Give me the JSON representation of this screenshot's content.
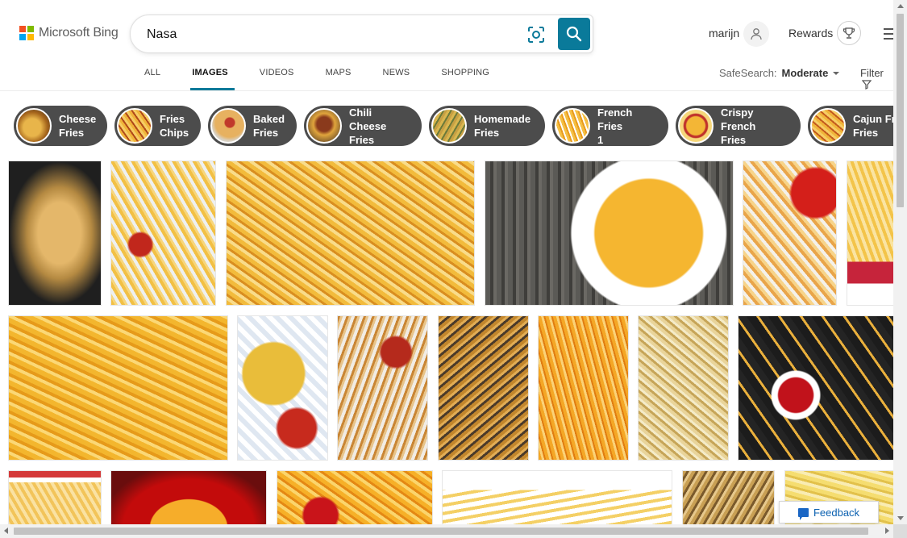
{
  "header": {
    "logo_text": "Microsoft Bing",
    "logo_colors": [
      "#f25022",
      "#7fba00",
      "#00a4ef",
      "#ffb900"
    ],
    "search_value": "Nasa",
    "accent_color": "#0a7a9a",
    "user_name": "marijn",
    "rewards_label": "Rewards"
  },
  "tabs": [
    {
      "label": "ALL",
      "active": false
    },
    {
      "label": "IMAGES",
      "active": true
    },
    {
      "label": "VIDEOS",
      "active": false
    },
    {
      "label": "MAPS",
      "active": false
    },
    {
      "label": "NEWS",
      "active": false
    },
    {
      "label": "SHOPPING",
      "active": false
    }
  ],
  "safesearch": {
    "label": "SafeSearch:",
    "value": "Moderate"
  },
  "filter_label": "Filter",
  "related_searches": [
    {
      "label": "Cheese\nFries"
    },
    {
      "label": "Fries\nChips"
    },
    {
      "label": "Baked\nFries"
    },
    {
      "label": "Chili Cheese\nFries"
    },
    {
      "label": "Homemade\nFries"
    },
    {
      "label": "French Fries\n1"
    },
    {
      "label": "Crispy French\nFries"
    },
    {
      "label": "Cajun Fre\nFries"
    }
  ],
  "feedback_label": "Feedback"
}
